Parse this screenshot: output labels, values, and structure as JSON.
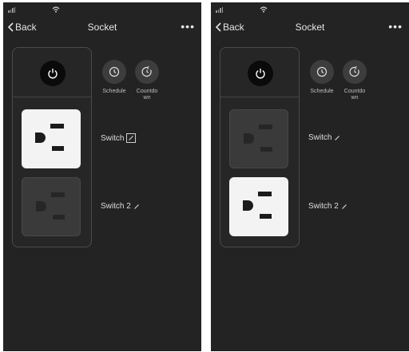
{
  "screens": [
    {
      "nav": {
        "back_label": "Back",
        "title": "Socket",
        "more_label": "•••"
      },
      "actions": {
        "schedule_label": "Schedule",
        "countdown_label": "Countdo\nwn"
      },
      "switches": [
        {
          "label": "Switch",
          "state": "on",
          "edit_icon": "pencil-icon"
        },
        {
          "label": "Switch 2",
          "state": "off",
          "edit_icon": "pencil-icon"
        }
      ]
    },
    {
      "nav": {
        "back_label": "Back",
        "title": "Socket",
        "more_label": "•••"
      },
      "actions": {
        "schedule_label": "Schedule",
        "countdown_label": "Countdo\nwn"
      },
      "switches": [
        {
          "label": "Switch",
          "state": "off",
          "edit_icon": "pencil-icon"
        },
        {
          "label": "Switch 2",
          "state": "on",
          "edit_icon": "pencil-icon"
        }
      ]
    }
  ],
  "colors": {
    "background": "#232323",
    "outlet_on": "#f3f3f3",
    "outlet_off": "#3a3a3a",
    "text": "#e6e6e6"
  }
}
